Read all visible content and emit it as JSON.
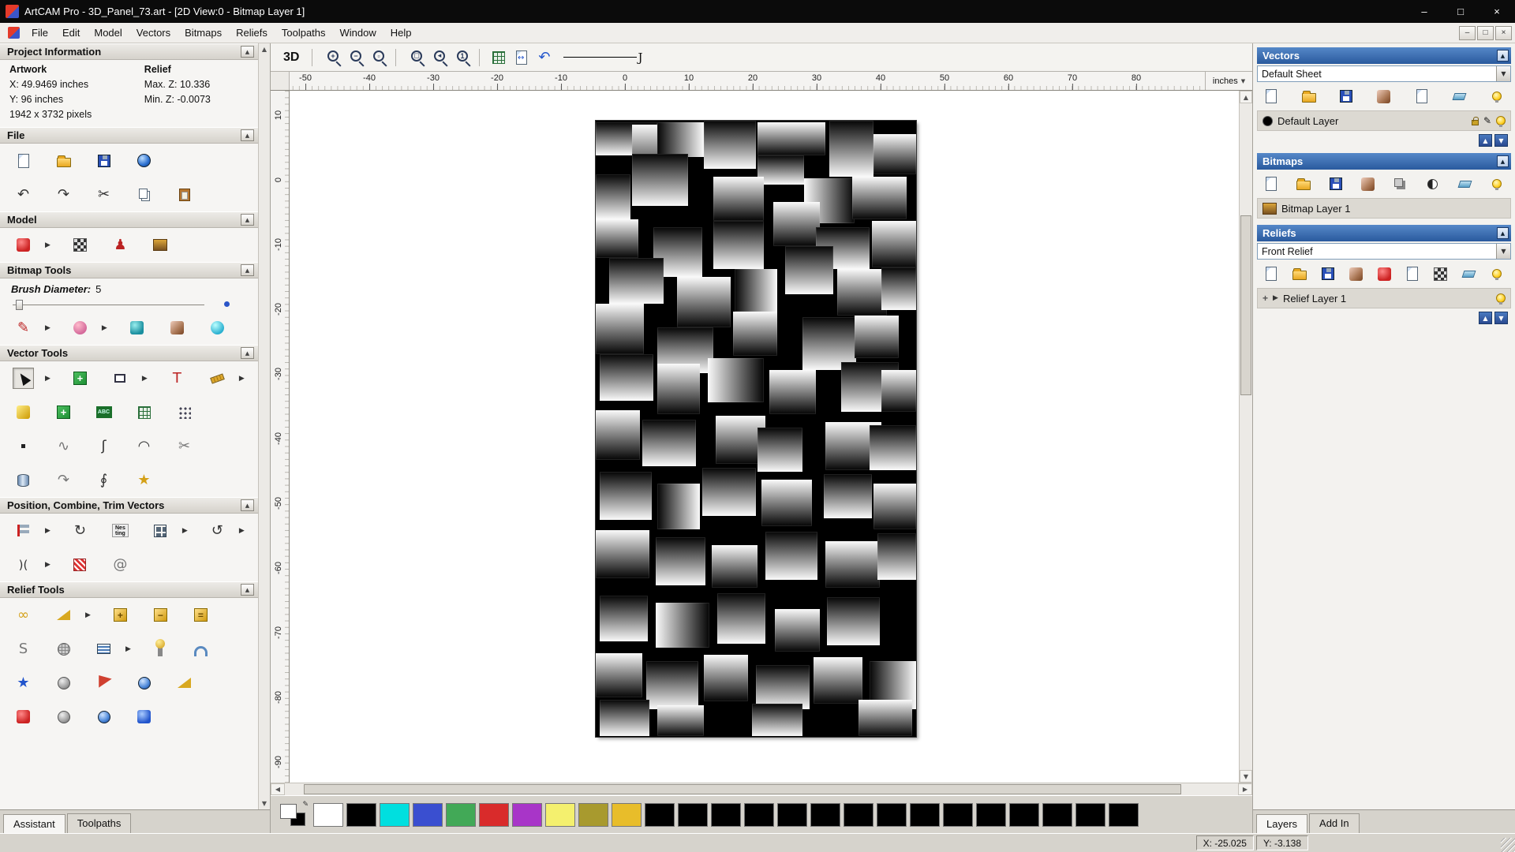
{
  "window": {
    "title": "ArtCAM Pro - 3D_Panel_73.art - [2D View:0 - Bitmap Layer 1]",
    "controls": {
      "minimize": "–",
      "maximize": "□",
      "close": "×"
    }
  },
  "menu": {
    "items": [
      "File",
      "Edit",
      "Model",
      "Vectors",
      "Bitmaps",
      "Reliefs",
      "Toolpaths",
      "Window",
      "Help"
    ],
    "child_controls": [
      "–",
      "□",
      "×"
    ]
  },
  "left": {
    "project_info": {
      "title": "Project Information",
      "artwork_header": "Artwork",
      "relief_header": "Relief",
      "artwork_rows": [
        "X: 49.9469 inches",
        "Y: 96 inches",
        "1942 x 3732 pixels"
      ],
      "relief_rows": [
        "Max. Z: 10.336",
        "Min. Z: -0.0073"
      ]
    },
    "file": {
      "title": "File",
      "row1": [
        "new",
        "open",
        "save",
        "model-transfer"
      ],
      "row2": [
        "undo",
        "redo",
        "cut",
        "copy",
        "paste"
      ]
    },
    "model": {
      "title": "Model",
      "icons": [
        "set-model-size*",
        "greyscale-preview",
        "martyr-model",
        "load-picture"
      ]
    },
    "bitmap_tools": {
      "title": "Bitmap Tools",
      "brush_label": "Brush Diameter:",
      "brush_value": "5",
      "icons": [
        "draw*",
        "paint*",
        "colour-picker",
        "palette",
        "flood-fill"
      ]
    },
    "vector_tools": {
      "title": "Vector Tools",
      "rows": [
        [
          "select*",
          "transform",
          "create-rectangle*",
          "create-text",
          "measure*"
        ],
        [
          "bitmap-to-vector",
          "create-cross",
          "text-on-curve",
          "create-grid",
          "node-editing"
        ],
        [
          "create-point",
          "wave",
          "create-curve",
          "create-arc",
          "trim-vectors"
        ],
        [
          "extrude-vector",
          "fillet",
          "join-vectors",
          "create-star"
        ]
      ]
    },
    "position_tools": {
      "title": "Position, Combine, Trim Vectors",
      "rows": [
        [
          "align-vectors*",
          "circular-copy",
          "nesting",
          "block-copy*",
          "rotate-copy*"
        ],
        [
          "mirror-vectors*",
          "weave-vectors",
          "spiral"
        ]
      ]
    },
    "relief_tools": {
      "title": "Relief Tools",
      "rows": [
        [
          "shape-editor",
          "smooth-relief*",
          "add-relief",
          "subtract-relief",
          "merge-relief"
        ],
        [
          "sculpt",
          "texture-relief",
          "offset-relief*",
          "interactive-sculpting",
          "two-rail-sweep"
        ],
        [
          "create-star-relief",
          "weave-relief",
          "turn-relief",
          "dome-relief",
          "angled-plane"
        ],
        [
          "extrude-relief",
          "spin-relief",
          "sphere-relief",
          "swirl-relief"
        ]
      ]
    },
    "tabs": [
      {
        "label": "Assistant",
        "active": true
      },
      {
        "label": "Toolpaths",
        "active": false
      }
    ]
  },
  "canvas": {
    "toolbar": {
      "view_3d": "3D",
      "zoom_icons": [
        "zoom-in",
        "zoom-out",
        "zoom-window"
      ],
      "view_icons": [
        "zoom-extents",
        "zoom-previous",
        "zoom-scale"
      ],
      "nav_icons": [
        "snap-grid",
        "pan-view",
        "previous-view"
      ]
    },
    "ruler": {
      "unit": "inches",
      "h_labels": [
        -50,
        -40,
        -30,
        -20,
        -10,
        0,
        10,
        20,
        30,
        40,
        50,
        60,
        70,
        80
      ],
      "v_labels": [
        10,
        0,
        -10,
        -20,
        -30,
        -40,
        -50,
        -60,
        -70,
        -80,
        -90
      ]
    },
    "panel": {
      "width_units": 332,
      "height_units": 638,
      "tiles": [
        [
          0,
          2,
          64,
          34,
          "tb"
        ],
        [
          38,
          4,
          52,
          58,
          "bt"
        ],
        [
          64,
          2,
          48,
          36,
          "lr"
        ],
        [
          112,
          0,
          54,
          50,
          "tb"
        ],
        [
          168,
          2,
          70,
          34,
          "bt"
        ],
        [
          242,
          0,
          46,
          58,
          "tb"
        ],
        [
          288,
          14,
          44,
          42,
          "bt"
        ],
        [
          38,
          34,
          58,
          54,
          "tb"
        ],
        [
          168,
          36,
          48,
          30,
          "tb"
        ],
        [
          122,
          58,
          52,
          46,
          "bt"
        ],
        [
          216,
          60,
          52,
          46,
          "rl"
        ],
        [
          266,
          58,
          56,
          44,
          "bt"
        ],
        [
          0,
          56,
          36,
          46,
          "tb"
        ],
        [
          0,
          102,
          44,
          40,
          "bt"
        ],
        [
          60,
          110,
          50,
          52,
          "tb"
        ],
        [
          122,
          104,
          52,
          50,
          "tb"
        ],
        [
          184,
          84,
          48,
          46,
          "bt"
        ],
        [
          228,
          110,
          56,
          44,
          "tb"
        ],
        [
          286,
          104,
          46,
          48,
          "bt"
        ],
        [
          14,
          142,
          56,
          48,
          "tb"
        ],
        [
          84,
          162,
          56,
          52,
          "bt"
        ],
        [
          144,
          154,
          44,
          44,
          "lr"
        ],
        [
          196,
          130,
          50,
          50,
          "tb"
        ],
        [
          250,
          154,
          52,
          48,
          "bt"
        ],
        [
          296,
          152,
          36,
          44,
          "tb"
        ],
        [
          0,
          190,
          50,
          52,
          "bt"
        ],
        [
          64,
          214,
          58,
          48,
          "tb"
        ],
        [
          142,
          198,
          46,
          46,
          "bt"
        ],
        [
          214,
          204,
          56,
          54,
          "tb"
        ],
        [
          268,
          202,
          46,
          44,
          "bt"
        ],
        [
          4,
          242,
          56,
          48,
          "tb"
        ],
        [
          64,
          252,
          44,
          52,
          "bt"
        ],
        [
          116,
          246,
          58,
          46,
          "rl"
        ],
        [
          180,
          258,
          48,
          46,
          "bt"
        ],
        [
          254,
          250,
          60,
          52,
          "tb"
        ],
        [
          296,
          258,
          36,
          44,
          "bt"
        ],
        [
          0,
          300,
          46,
          52,
          "bt"
        ],
        [
          48,
          310,
          56,
          48,
          "tb"
        ],
        [
          124,
          306,
          52,
          50,
          "bt"
        ],
        [
          168,
          318,
          46,
          46,
          "tb"
        ],
        [
          238,
          312,
          58,
          50,
          "bt"
        ],
        [
          284,
          316,
          48,
          46,
          "tb"
        ],
        [
          4,
          364,
          54,
          50,
          "tb"
        ],
        [
          64,
          376,
          44,
          48,
          "lr"
        ],
        [
          110,
          360,
          56,
          50,
          "tb"
        ],
        [
          172,
          372,
          52,
          48,
          "bt"
        ],
        [
          236,
          366,
          50,
          46,
          "tb"
        ],
        [
          288,
          376,
          44,
          48,
          "bt"
        ],
        [
          0,
          424,
          56,
          50,
          "bt"
        ],
        [
          62,
          432,
          52,
          50,
          "tb"
        ],
        [
          120,
          440,
          48,
          44,
          "bt"
        ],
        [
          176,
          426,
          54,
          50,
          "tb"
        ],
        [
          238,
          436,
          56,
          48,
          "bt"
        ],
        [
          292,
          428,
          40,
          48,
          "tb"
        ],
        [
          4,
          492,
          50,
          48,
          "tb"
        ],
        [
          62,
          500,
          56,
          46,
          "rl"
        ],
        [
          126,
          490,
          50,
          52,
          "tb"
        ],
        [
          186,
          506,
          46,
          44,
          "bt"
        ],
        [
          240,
          494,
          54,
          50,
          "tb"
        ],
        [
          0,
          552,
          48,
          46,
          "bt"
        ],
        [
          52,
          560,
          54,
          50,
          "tb"
        ],
        [
          112,
          554,
          46,
          48,
          "bt"
        ],
        [
          166,
          564,
          56,
          46,
          "tb"
        ],
        [
          226,
          556,
          50,
          48,
          "bt"
        ],
        [
          284,
          560,
          48,
          50,
          "lr"
        ],
        [
          4,
          600,
          52,
          38,
          "tb"
        ],
        [
          64,
          606,
          48,
          32,
          "bt"
        ],
        [
          162,
          604,
          52,
          34,
          "tb"
        ],
        [
          272,
          600,
          56,
          38,
          "bt"
        ]
      ]
    },
    "status": {
      "x": "X: -25.025",
      "y": "Y: -3.138"
    }
  },
  "right": {
    "vectors": {
      "title": "Vectors",
      "sheet": "Default Sheet",
      "toolbar": [
        "new-vector",
        "open-vector",
        "save-vector",
        "import-vector",
        "export-vector",
        "delete-vector",
        "toggle-visibility"
      ],
      "layer": {
        "name": "Default Layer",
        "swatch": "#000000"
      }
    },
    "bitmaps": {
      "title": "Bitmaps",
      "toolbar": [
        "new-bitmap",
        "open-bitmap",
        "save-bitmap",
        "import-bitmap",
        "merge-bitmap",
        "contrast",
        "delete-bitmap",
        "toggle-all"
      ],
      "layer": {
        "name": "Bitmap Layer 1"
      }
    },
    "reliefs": {
      "title": "Reliefs",
      "relief": "Front Relief",
      "toolbar": [
        "new-relief",
        "open-relief",
        "save-relief",
        "import-relief",
        "paste-relief",
        "export-relief",
        "texture-tile",
        "delete-relief",
        "toggle-relief"
      ],
      "layer": {
        "name": "Relief Layer 1"
      }
    },
    "tabs": [
      {
        "label": "Layers",
        "active": true
      },
      {
        "label": "Add In",
        "active": false
      }
    ]
  },
  "palette": {
    "colors": [
      "#ffffff",
      "#000000",
      "#00dfdf",
      "#3a4fd0",
      "#42a957",
      "#d92b2b",
      "#a835c8",
      "#f4f06e",
      "#a89a2e",
      "#e8bd2a",
      "#000000",
      "#000000",
      "#000000",
      "#000000",
      "#000000",
      "#000000",
      "#000000",
      "#000000",
      "#000000",
      "#000000",
      "#000000",
      "#000000",
      "#000000",
      "#000000",
      "#000000"
    ]
  }
}
